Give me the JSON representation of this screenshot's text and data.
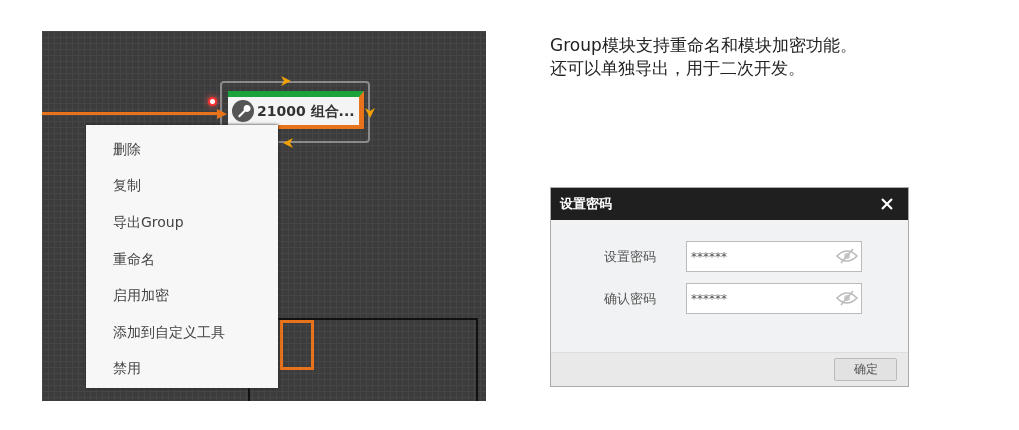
{
  "canvas": {
    "node": {
      "label": "21000 组合..."
    },
    "context_menu": [
      {
        "label": "删除"
      },
      {
        "label": "复制"
      },
      {
        "label": "导出Group"
      },
      {
        "label": "重命名"
      },
      {
        "label": "启用加密"
      },
      {
        "label": "添加到自定义工具"
      },
      {
        "label": "禁用"
      }
    ]
  },
  "description": [
    "Group模块支持重命名和模块加密功能。",
    "还可以单独导出，用于二次开发。"
  ],
  "dialog": {
    "title": "设置密码",
    "fields": [
      {
        "label": "设置密码",
        "value": "******"
      },
      {
        "label": "确认密码",
        "value": "******"
      }
    ],
    "button": "确定"
  }
}
